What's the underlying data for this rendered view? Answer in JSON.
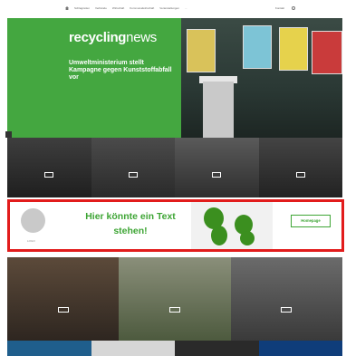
{
  "nav": {
    "items": [
      "Schlagzeilen",
      "Verbände",
      "Wirtschaft",
      "Kommunalwirtschaft",
      "Veranstaltungen",
      "..."
    ],
    "right_items": [
      "Kontakt"
    ]
  },
  "hero": {
    "logo_main": "recycling",
    "logo_thin": "news",
    "tagline": "",
    "meta": "",
    "headline": "Umweltministerium stellt Kampagne gegen Kunststoffabfall vor",
    "teaser": "",
    "more_label": "",
    "colors": {
      "green": "#44a740"
    }
  },
  "tiles": [
    {
      "title": "",
      "button": ""
    },
    {
      "title": "",
      "button": ""
    },
    {
      "title": "",
      "button": ""
    },
    {
      "title": "",
      "button": ""
    }
  ],
  "ad": {
    "logo_text": "LOGO",
    "text": "Hier könnte ein Text stehen!",
    "cta": "Homepage",
    "cta_sub": "",
    "border_color": "#e21c1c"
  },
  "cards": [
    {
      "title": "",
      "button": ""
    },
    {
      "title": "",
      "button": ""
    },
    {
      "title": "",
      "button": ""
    }
  ]
}
